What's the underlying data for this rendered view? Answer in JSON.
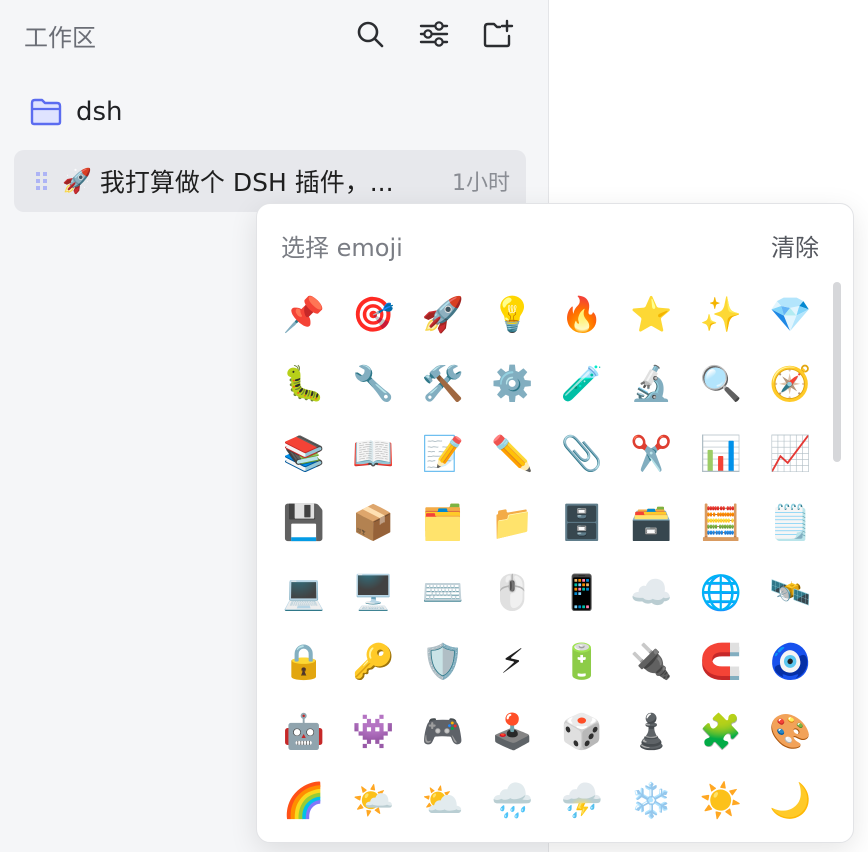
{
  "sidebar": {
    "title": "工作区",
    "folder": {
      "name": "dsh",
      "icon": "folder-icon"
    },
    "doc": {
      "emoji": "🚀",
      "title": "我打算做个 DSH 插件，...",
      "time": "1小时"
    },
    "toolbar_icons": [
      "search-icon",
      "filter-sliders-icon",
      "new-folder-icon"
    ]
  },
  "emoji_picker": {
    "title": "选择 emoji",
    "clear_label": "清除",
    "emojis": [
      "📌",
      "🎯",
      "🚀",
      "💡",
      "🔥",
      "⭐",
      "✨",
      "💎",
      "🐛",
      "🔧",
      "🛠️",
      "⚙️",
      "🧪",
      "🔬",
      "🔍",
      "🧭",
      "📚",
      "📖",
      "📝",
      "✏️",
      "📎",
      "✂️",
      "📊",
      "📈",
      "💾",
      "📦",
      "🗂️",
      "📁",
      "🗄️",
      "🗃️",
      "🧮",
      "🗒️",
      "💻",
      "🖥️",
      "⌨️",
      "🖱️",
      "📱",
      "☁️",
      "🌐",
      "🛰️",
      "🔒",
      "🔑",
      "🛡️",
      "⚡",
      "🔋",
      "🔌",
      "🧲",
      "🧿",
      "🤖",
      "👾",
      "🎮",
      "🕹️",
      "🎲",
      "♟️",
      "🧩",
      "🎨",
      "🌈",
      "🌤️",
      "⛅",
      "🌧️",
      "⛈️",
      "❄️",
      "☀️",
      "🌙"
    ]
  },
  "colors": {
    "folder_accent": "#5b6cf0",
    "sidebar_bg": "#f5f6f8"
  }
}
